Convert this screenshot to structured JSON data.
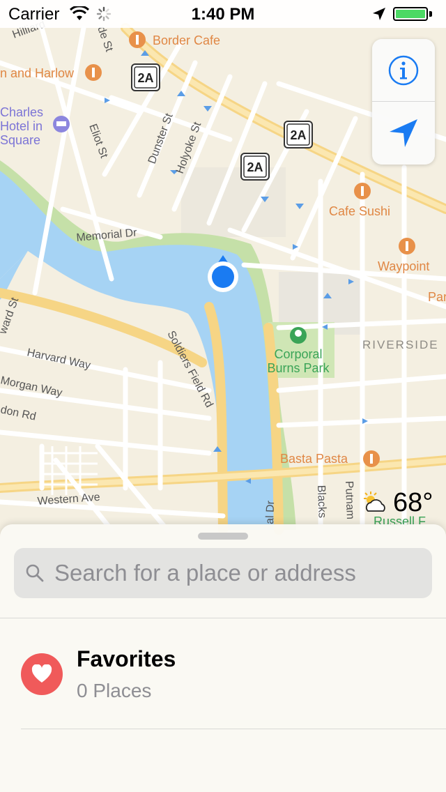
{
  "status_bar": {
    "carrier": "Carrier",
    "time": "1:40 PM",
    "battery_level": 1.0
  },
  "map": {
    "labels": {
      "border_cafe": "Border Cafe",
      "hilliard": "Hilliard",
      "harlow": "n and Harlow",
      "charles_hotel": [
        "Charles",
        "Hotel in",
        "Square"
      ],
      "eliot_st": "Eliot St",
      "dunster_st": "Dunster St",
      "holyoke_st": "Holyoke St",
      "de_st": "de St",
      "memorial_dr": "Memorial Dr",
      "cafe_sushi": "Cafe Sushi",
      "waypoint": "Waypoint",
      "par": "Par",
      "riverside": "RIVERSIDE",
      "corporal_burns_park": [
        "Corporal",
        "Burns Park"
      ],
      "ward_st": "ward St",
      "harvard_way": "Harvard Way",
      "morgan_way": "Morgan Way",
      "don_rd": "don Rd",
      "soldiers_field_rd": "Soldiers Field Rd",
      "basta_pasta": "Basta Pasta",
      "western_ave": "Western Ave",
      "al_dr": "al Dr",
      "blacks": "Blacks",
      "putnam": "Putnam",
      "russell_f": "Russell F"
    },
    "route_shields": [
      "2A",
      "2A",
      "2A"
    ]
  },
  "map_controls": {
    "info_icon": "info-icon",
    "tracking_icon": "location-arrow-icon"
  },
  "weather": {
    "temperature": "68°",
    "icon": "partly-cloudy-icon"
  },
  "sheet": {
    "search_placeholder": "Search for a place or address",
    "favorites": {
      "title": "Favorites",
      "subtitle": "0 Places"
    }
  },
  "colors": {
    "water": "#a6d3f4",
    "park": "#c5e0a8",
    "road": "#ffffff",
    "major_road": "#f9dc8f",
    "poi_orange": "#e8914a",
    "park_green": "#3aa457",
    "user_location": "#1a7bf2",
    "heart_red": "#f05a5a",
    "ios_blue": "#1a7bf2"
  }
}
